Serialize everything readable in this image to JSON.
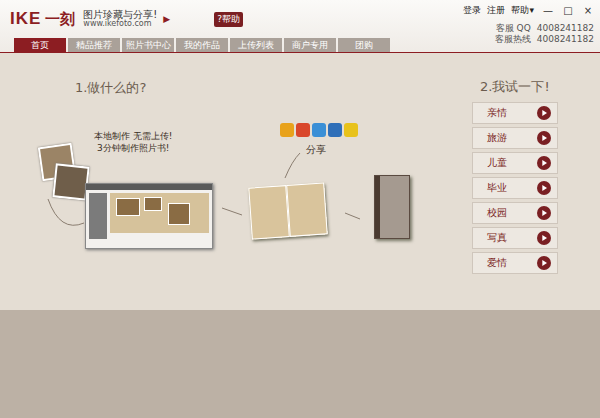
{
  "window": {
    "logo_latin": "IKE",
    "logo_cn": "一刻",
    "slogan": "图片珍藏与分享!",
    "url": "www.ikefoto.com",
    "arrow": "▶",
    "help_button": "?帮助",
    "links": [
      "登录",
      "注册",
      "帮助▾"
    ],
    "controls": [
      "—",
      "□",
      "×"
    ]
  },
  "support": [
    {
      "label": "客服 QQ",
      "value": "4008241182"
    },
    {
      "label": "客服热线",
      "value": "4008241182"
    }
  ],
  "tabs": [
    {
      "label": "首页",
      "selected": true
    },
    {
      "label": "精品推荐",
      "selected": false
    },
    {
      "label": "照片书中心",
      "selected": false
    },
    {
      "label": "我的作品",
      "selected": false
    },
    {
      "label": "上传列表",
      "selected": false
    },
    {
      "label": "商户专用",
      "selected": false
    },
    {
      "label": "团购",
      "selected": false
    }
  ],
  "intro": {
    "title": "1.做什么的?",
    "caption": [
      "本地制作 无需上传!",
      "3分钟制作照片书!"
    ],
    "share_label": "分享"
  },
  "trial": {
    "title": "2.我试一下!",
    "buttons": [
      "亲情",
      "旅游",
      "儿童",
      "毕业",
      "校园",
      "写真",
      "爱情"
    ]
  }
}
